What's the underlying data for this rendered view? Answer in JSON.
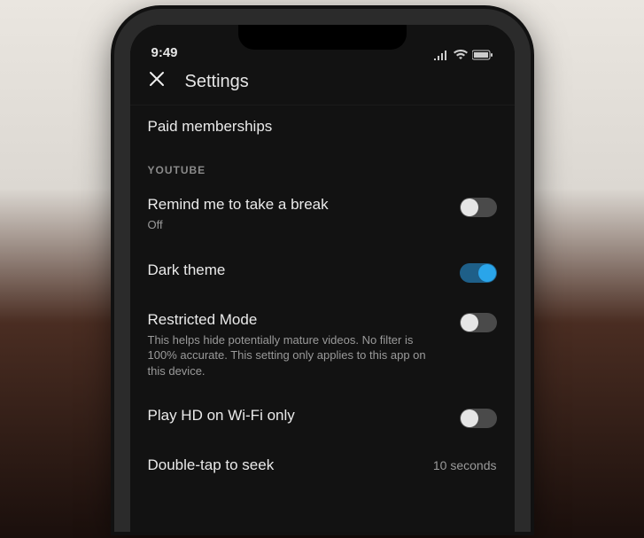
{
  "status": {
    "time": "9:49"
  },
  "header": {
    "title": "Settings"
  },
  "paid": {
    "label": "Paid memberships"
  },
  "section": {
    "label": "YOUTUBE"
  },
  "break": {
    "label": "Remind me to take a break",
    "value": "Off"
  },
  "dark": {
    "label": "Dark theme"
  },
  "restricted": {
    "label": "Restricted Mode",
    "desc": "This helps hide potentially mature videos. No filter is 100% accurate. This setting only applies to this app on this device."
  },
  "hd": {
    "label": "Play HD on Wi-Fi only"
  },
  "seek": {
    "label": "Double-tap to seek",
    "value": "10 seconds"
  },
  "toggles": {
    "break": false,
    "dark": true,
    "restricted": false,
    "hd": false
  }
}
